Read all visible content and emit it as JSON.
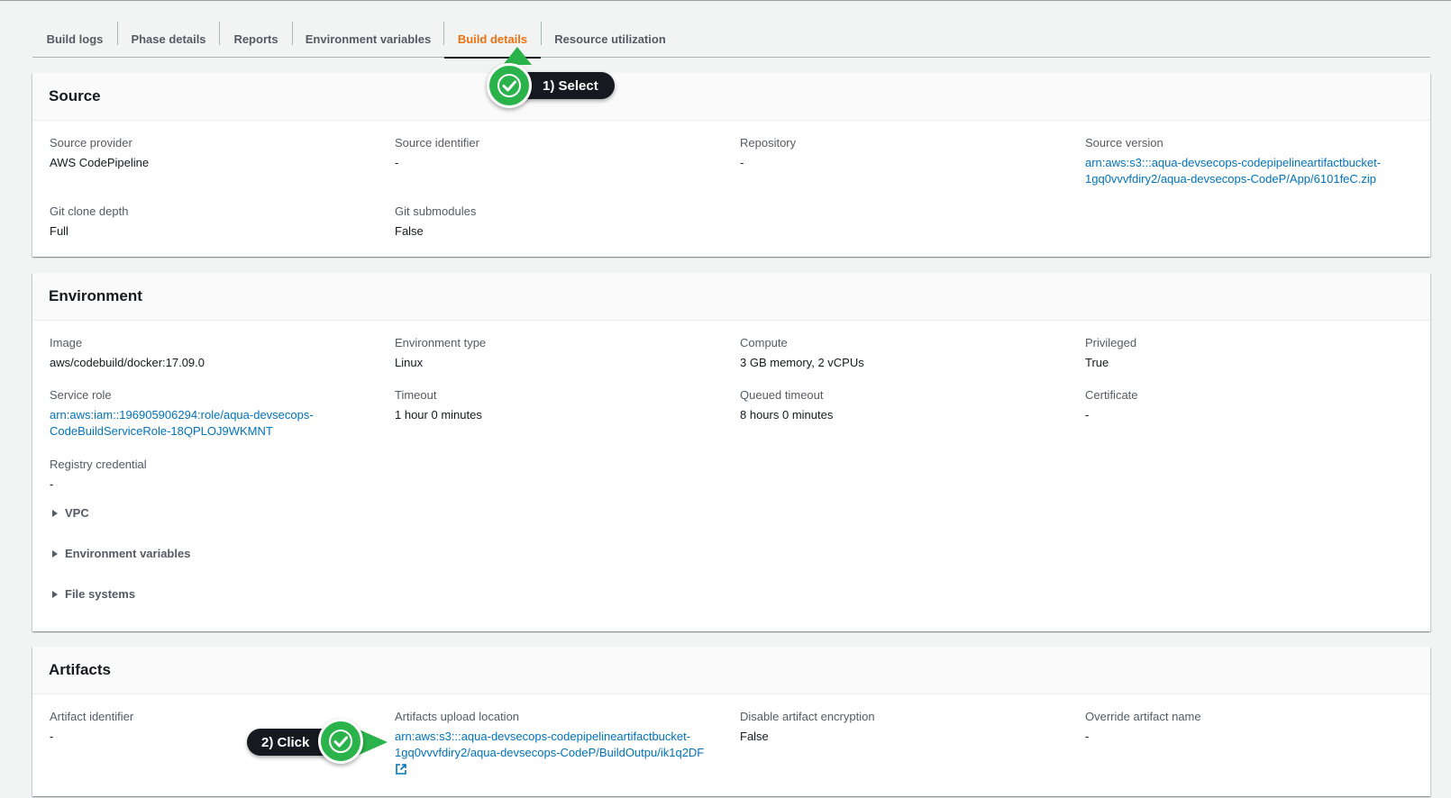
{
  "tabs": [
    {
      "label": "Build logs",
      "active": false
    },
    {
      "label": "Phase details",
      "active": false
    },
    {
      "label": "Reports",
      "active": false
    },
    {
      "label": "Environment variables",
      "active": false
    },
    {
      "label": "Build details",
      "active": true
    },
    {
      "label": "Resource utilization",
      "active": false
    }
  ],
  "source": {
    "title": "Source",
    "provider_label": "Source provider",
    "provider_value": "AWS CodePipeline",
    "identifier_label": "Source identifier",
    "identifier_value": "-",
    "repository_label": "Repository",
    "repository_value": "-",
    "version_label": "Source version",
    "version_line1": "arn:aws:s3:::aqua-devsecops-codepipelineartifactbucket-",
    "version_line2": "1gq0vvvfdiry2/aqua-devsecops-CodeP/App/6101feC.zip",
    "clone_depth_label": "Git clone depth",
    "clone_depth_value": "Full",
    "submodules_label": "Git submodules",
    "submodules_value": "False"
  },
  "environment": {
    "title": "Environment",
    "image_label": "Image",
    "image_value": "aws/codebuild/docker:17.09.0",
    "type_label": "Environment type",
    "type_value": "Linux",
    "compute_label": "Compute",
    "compute_value": "3 GB memory, 2 vCPUs",
    "privileged_label": "Privileged",
    "privileged_value": "True",
    "service_role_label": "Service role",
    "service_role_line1": "arn:aws:iam::196905906294:role/aqua-devsecops-",
    "service_role_line2": "CodeBuildServiceRole-18QPLOJ9WKMNT",
    "timeout_label": "Timeout",
    "timeout_value": "1 hour 0 minutes",
    "queued_timeout_label": "Queued timeout",
    "queued_timeout_value": "8 hours 0 minutes",
    "certificate_label": "Certificate",
    "certificate_value": "-",
    "registry_label": "Registry credential",
    "registry_value": "-",
    "expanders": [
      "VPC",
      "Environment variables",
      "File systems"
    ]
  },
  "artifacts": {
    "title": "Artifacts",
    "identifier_label": "Artifact identifier",
    "identifier_value": "-",
    "upload_label": "Artifacts upload location",
    "upload_line1": "arn:aws:s3:::aqua-devsecops-codepipelineartifactbucket-",
    "upload_line2": "1gq0vvvfdiry2/aqua-devsecops-CodeP/BuildOutpu/ik1q2DF",
    "encryption_label": "Disable artifact encryption",
    "encryption_value": "False",
    "override_label": "Override artifact name",
    "override_value": "-"
  },
  "callouts": {
    "select": "1) Select",
    "click": "2) Click"
  },
  "icons": {
    "external_link": "external-link-icon",
    "check": "check-icon",
    "caret": "caret-right-icon"
  },
  "colors": {
    "link": "#0073bb",
    "active_tab": "#ec7211",
    "callout_green": "#2ab34a",
    "callout_dark": "#16191f"
  }
}
